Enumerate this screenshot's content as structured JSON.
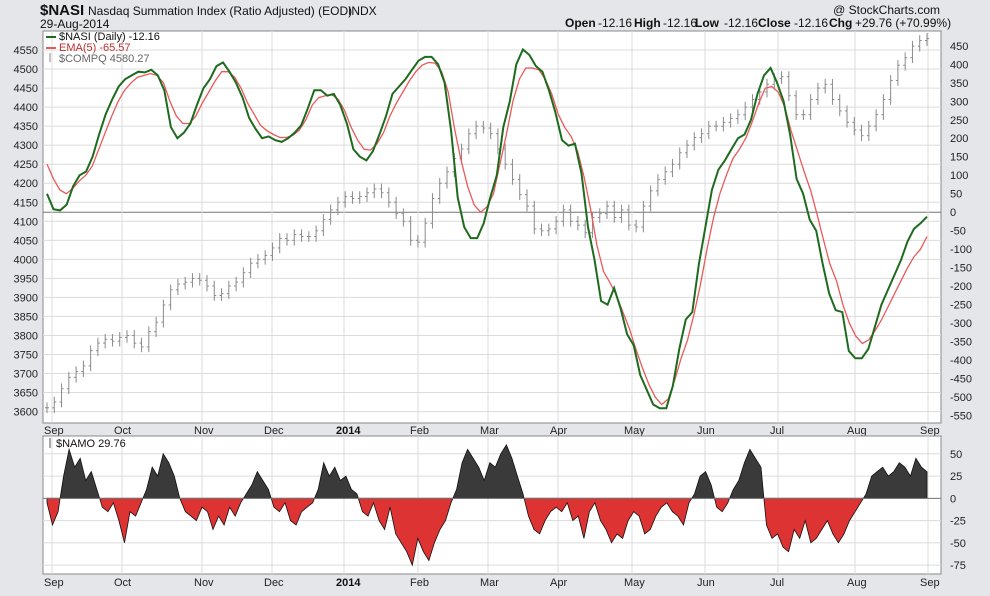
{
  "header": {
    "symbol": "$NASI",
    "title": "Nasdaq Summation Index (Ratio Adjusted) (EOD)",
    "exchange": "INDX",
    "date": "29-Aug-2014",
    "watermark": "@ StockCharts.com",
    "open_label": "Open",
    "open_value": "-12.16",
    "high_label": "High",
    "high_value": "-12.16",
    "low_label": "Low",
    "low_value": "-12.16",
    "close_label": "Close",
    "close_value": "-12.16",
    "chg_label": "Chg",
    "chg_value": "+29.76 (+70.99%)"
  },
  "legend": {
    "nasi": "$NASI (Daily) -12.16",
    "ema": "EMA(5) -65.57",
    "compq": "$COMPQ 4580.27"
  },
  "lower_legend": "$NAMO 29.76",
  "colors": {
    "nasi": "#1e6a1e",
    "ema": "#e85a5a",
    "compq": "#8a8a8a",
    "namo_pos": "#3a3a3a",
    "namo_neg": "#dd3333",
    "grid": "#dcdcdc",
    "panel_bg": "#ffffff",
    "page_bg": "#e4e6ea"
  },
  "chart_data": [
    {
      "type": "line",
      "title": "Nasdaq Summation Index (Ratio Adjusted) (EOD)",
      "x_labels": [
        "Sep",
        "Oct",
        "Nov",
        "Dec",
        "2014",
        "Feb",
        "Mar",
        "Apr",
        "May",
        "Jun",
        "Jul",
        "Aug",
        "Sep"
      ],
      "left_axis": {
        "ylim": [
          3570,
          4600
        ],
        "ticks": [
          3600,
          3650,
          3700,
          3750,
          3800,
          3850,
          3900,
          3950,
          4000,
          4050,
          4100,
          4150,
          4200,
          4250,
          4300,
          4350,
          4400,
          4450,
          4500,
          4550
        ]
      },
      "right_axis": {
        "ylim": [
          -570,
          490
        ],
        "ticks": [
          450,
          400,
          350,
          300,
          250,
          200,
          150,
          100,
          50,
          0,
          -50,
          -100,
          -150,
          -200,
          -250,
          -300,
          -350,
          -400,
          -450,
          -500,
          -550
        ]
      },
      "zero_line": 0,
      "series": [
        {
          "name": "$NASI (Daily)",
          "axis": "right",
          "values": [
            50,
            8,
            5,
            20,
            70,
            100,
            110,
            150,
            210,
            265,
            305,
            340,
            360,
            370,
            380,
            378,
            385,
            370,
            330,
            230,
            200,
            215,
            240,
            290,
            335,
            360,
            395,
            405,
            380,
            350,
            310,
            255,
            225,
            200,
            205,
            195,
            190,
            200,
            215,
            235,
            280,
            330,
            330,
            315,
            320,
            290,
            240,
            170,
            150,
            140,
            165,
            210,
            260,
            320,
            340,
            360,
            385,
            410,
            420,
            420,
            400,
            350,
            220,
            40,
            -40,
            -70,
            -70,
            -30,
            40,
            100,
            230,
            300,
            400,
            440,
            425,
            395,
            380,
            330,
            270,
            195,
            180,
            185,
            105,
            -40,
            -130,
            -240,
            -250,
            -205,
            -260,
            -330,
            -360,
            -440,
            -480,
            -520,
            -530,
            -530,
            -470,
            -370,
            -290,
            -270,
            -140,
            -40,
            60,
            115,
            140,
            170,
            200,
            210,
            250,
            320,
            370,
            390,
            350,
            300,
            210,
            90,
            50,
            -20,
            -50,
            -140,
            -220,
            -265,
            -270,
            -375,
            -395,
            -395,
            -370,
            -310,
            -250,
            -210,
            -170,
            -130,
            -80,
            -45,
            -30,
            -12.16
          ]
        },
        {
          "name": "EMA(5)",
          "axis": "right",
          "values": [
            130,
            90,
            60,
            50,
            65,
            85,
            100,
            125,
            170,
            215,
            260,
            300,
            330,
            350,
            365,
            370,
            375,
            370,
            350,
            300,
            260,
            240,
            240,
            260,
            295,
            325,
            355,
            380,
            380,
            365,
            335,
            295,
            265,
            235,
            220,
            210,
            202,
            202,
            208,
            222,
            250,
            290,
            310,
            315,
            318,
            305,
            275,
            230,
            195,
            170,
            168,
            185,
            215,
            260,
            295,
            325,
            355,
            380,
            398,
            405,
            403,
            380,
            325,
            225,
            140,
            70,
            20,
            0,
            15,
            50,
            130,
            210,
            300,
            360,
            390,
            390,
            385,
            360,
            320,
            265,
            230,
            205,
            165,
            95,
            10,
            -90,
            -160,
            -190,
            -225,
            -270,
            -315,
            -370,
            -420,
            -465,
            -500,
            -520,
            -505,
            -455,
            -395,
            -345,
            -275,
            -195,
            -100,
            -15,
            50,
            100,
            145,
            170,
            200,
            245,
            295,
            335,
            340,
            325,
            285,
            220,
            165,
            110,
            60,
            -5,
            -75,
            -140,
            -185,
            -250,
            -300,
            -335,
            -355,
            -345,
            -320,
            -290,
            -255,
            -220,
            -185,
            -150,
            -120,
            -100,
            -65.57
          ]
        },
        {
          "name": "$COMPQ",
          "axis": "left",
          "values": [
            3610,
            3625,
            3660,
            3690,
            3705,
            3720,
            3760,
            3780,
            3790,
            3785,
            3795,
            3800,
            3780,
            3770,
            3810,
            3835,
            3880,
            3920,
            3935,
            3940,
            3950,
            3945,
            3930,
            3905,
            3910,
            3930,
            3940,
            3965,
            3990,
            4000,
            4010,
            4030,
            4055,
            4050,
            4065,
            4060,
            4060,
            4075,
            4105,
            4130,
            4150,
            4165,
            4160,
            4165,
            4175,
            4185,
            4175,
            4150,
            4120,
            4100,
            4050,
            4045,
            4095,
            4160,
            4200,
            4230,
            4265,
            4290,
            4330,
            4350,
            4345,
            4330,
            4290,
            4250,
            4210,
            4170,
            4140,
            4080,
            4075,
            4080,
            4100,
            4130,
            4100,
            4090,
            4070,
            4110,
            4120,
            4140,
            4110,
            4130,
            4090,
            4085,
            4140,
            4180,
            4210,
            4230,
            4250,
            4280,
            4300,
            4320,
            4330,
            4350,
            4350,
            4360,
            4370,
            4380,
            4400,
            4420,
            4440,
            4460,
            4475,
            4480,
            4430,
            4380,
            4380,
            4420,
            4450,
            4460,
            4420,
            4390,
            4360,
            4340,
            4325,
            4350,
            4380,
            4420,
            4470,
            4510,
            4530,
            4560,
            4575,
            4580.27
          ]
        }
      ]
    },
    {
      "type": "area",
      "title": "$NAMO",
      "x_labels": [
        "Sep",
        "Oct",
        "Nov",
        "Dec",
        "2014",
        "Feb",
        "Mar",
        "Apr",
        "May",
        "Jun",
        "Jul",
        "Aug",
        "Sep"
      ],
      "ylim": [
        -85,
        70
      ],
      "ticks": [
        50,
        25,
        0,
        -25,
        -50,
        -75
      ],
      "series": [
        {
          "name": "$NAMO",
          "values": [
            -5,
            -30,
            -15,
            25,
            55,
            35,
            45,
            20,
            30,
            10,
            -10,
            -15,
            -5,
            -25,
            -50,
            -15,
            -20,
            -5,
            10,
            35,
            25,
            50,
            40,
            25,
            0,
            -15,
            -20,
            -25,
            -10,
            -15,
            -35,
            -20,
            -30,
            -10,
            -20,
            -5,
            5,
            15,
            30,
            20,
            10,
            -10,
            -15,
            -5,
            -25,
            -30,
            -15,
            -10,
            -5,
            10,
            40,
            25,
            35,
            20,
            25,
            10,
            5,
            -15,
            -20,
            -5,
            -25,
            -35,
            -10,
            -40,
            -50,
            -60,
            -75,
            -45,
            -60,
            -70,
            -50,
            -35,
            -25,
            -5,
            10,
            40,
            55,
            45,
            35,
            20,
            40,
            35,
            50,
            60,
            45,
            25,
            5,
            -20,
            -35,
            -40,
            -25,
            -15,
            -10,
            -15,
            -5,
            -25,
            -20,
            -45,
            -15,
            -5,
            -25,
            -35,
            -50,
            -40,
            -45,
            -25,
            -15,
            -20,
            -40,
            -35,
            -20,
            -10,
            -5,
            -15,
            -20,
            -30,
            -5,
            5,
            25,
            30,
            15,
            -10,
            -15,
            -5,
            10,
            20,
            40,
            55,
            45,
            35,
            -30,
            -45,
            -40,
            -55,
            -60,
            -35,
            -45,
            -25,
            -50,
            -45,
            -35,
            -25,
            -40,
            -50,
            -40,
            -25,
            -15,
            -5,
            5,
            25,
            30,
            35,
            25,
            30,
            40,
            35,
            25,
            45,
            35,
            29.76
          ]
        }
      ]
    }
  ]
}
